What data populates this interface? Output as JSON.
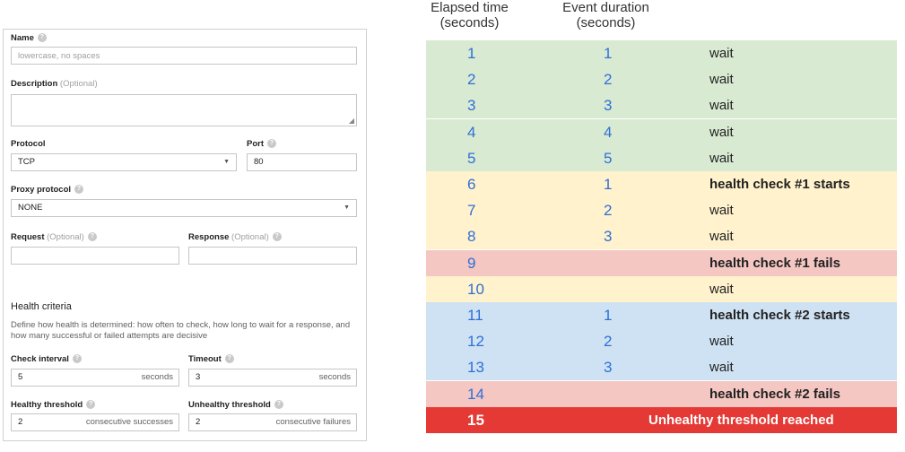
{
  "form": {
    "name_label": "Name",
    "name_placeholder": "lowercase, no spaces",
    "description_label": "Description",
    "optional": "(Optional)",
    "protocol_label": "Protocol",
    "protocol_value": "TCP",
    "port_label": "Port",
    "port_value": "80",
    "proxy_label": "Proxy protocol",
    "proxy_value": "NONE",
    "request_label": "Request",
    "response_label": "Response",
    "health_title": "Health criteria",
    "health_desc": "Define how health is determined: how often to check, how long to wait for a response, and how many successful or failed attempts are decisive",
    "interval_label": "Check interval",
    "interval_value": "5",
    "timeout_label": "Timeout",
    "timeout_value": "3",
    "seconds_unit": "seconds",
    "healthy_label": "Healthy threshold",
    "healthy_value": "2",
    "healthy_unit": "consecutive successes",
    "unhealthy_label": "Unhealthy threshold",
    "unhealthy_value": "2",
    "unhealthy_unit": "consecutive failures",
    "help_glyph": "?"
  },
  "timeline": {
    "header_elapsed_1": "Elapsed time",
    "header_elapsed_2": "(seconds)",
    "header_duration_1": "Event duration",
    "header_duration_2": "(seconds)",
    "rows": [
      {
        "elapsed": "1",
        "duration": "1",
        "event": "wait",
        "bold": false,
        "color": "#d9ead3"
      },
      {
        "elapsed": "2",
        "duration": "2",
        "event": "wait",
        "bold": false,
        "color": "#d9ead3"
      },
      {
        "elapsed": "3",
        "duration": "3",
        "event": "wait",
        "bold": false,
        "color": "#d9ead3"
      },
      {
        "elapsed": "4",
        "duration": "4",
        "event": "wait",
        "bold": false,
        "color": "#d9ead3"
      },
      {
        "elapsed": "5",
        "duration": "5",
        "event": "wait",
        "bold": false,
        "color": "#d9ead3"
      },
      {
        "elapsed": "6",
        "duration": "1",
        "event": "health check #1 starts",
        "bold": true,
        "color": "#fff2cc"
      },
      {
        "elapsed": "7",
        "duration": "2",
        "event": "wait",
        "bold": false,
        "color": "#fff2cc"
      },
      {
        "elapsed": "8",
        "duration": "3",
        "event": "wait",
        "bold": false,
        "color": "#fff2cc"
      },
      {
        "elapsed": "9",
        "duration": "",
        "event": "health check #1 fails",
        "bold": true,
        "color": "#f4c7c3"
      },
      {
        "elapsed": "10",
        "duration": "",
        "event": "wait",
        "bold": false,
        "color": "#fff2cc"
      },
      {
        "elapsed": "11",
        "duration": "1",
        "event": "health check #2 starts",
        "bold": true,
        "color": "#cfe2f3"
      },
      {
        "elapsed": "12",
        "duration": "2",
        "event": "wait",
        "bold": false,
        "color": "#cfe2f3"
      },
      {
        "elapsed": "13",
        "duration": "3",
        "event": "wait",
        "bold": false,
        "color": "#cfe2f3"
      },
      {
        "elapsed": "14",
        "duration": "",
        "event": "health check #2 fails",
        "bold": true,
        "color": "#f4c7c3"
      },
      {
        "elapsed": "15",
        "duration": "",
        "event": "Unhealthy threshold reached",
        "bold": true,
        "color": "#e53935"
      }
    ]
  }
}
